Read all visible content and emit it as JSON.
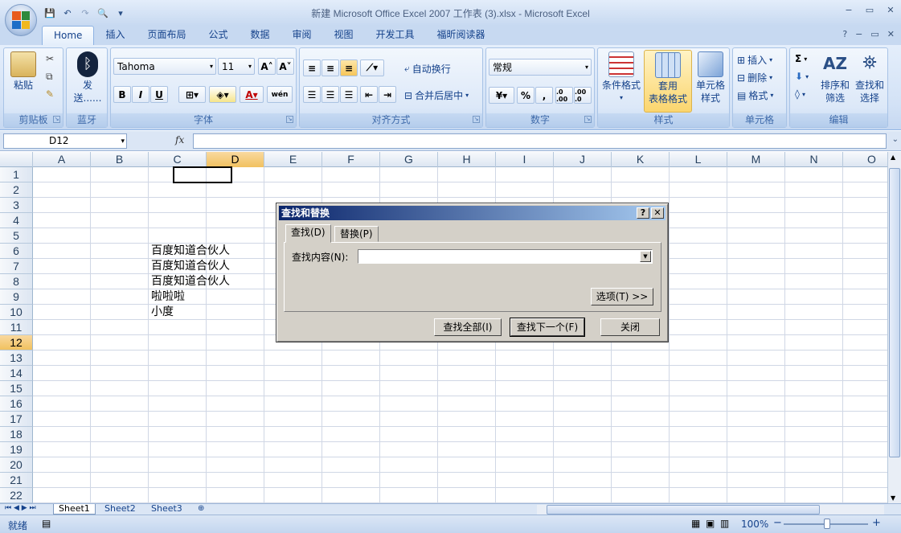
{
  "window": {
    "title": "新建 Microsoft Office Excel 2007 工作表 (3).xlsx - Microsoft Excel",
    "minimize": "−",
    "restore": "▭",
    "close": "✕"
  },
  "qat": {
    "save": "💾",
    "undo": "↶",
    "redo": "↷",
    "preview": "🔍",
    "more": "▾"
  },
  "tabs": [
    {
      "label": "Home",
      "active": true
    },
    {
      "label": "插入"
    },
    {
      "label": "页面布局"
    },
    {
      "label": "公式"
    },
    {
      "label": "数据"
    },
    {
      "label": "审阅"
    },
    {
      "label": "视图"
    },
    {
      "label": "开发工具"
    },
    {
      "label": "福昕阅读器"
    }
  ],
  "tab_controls": {
    "help": "?",
    "min": "−",
    "restore": "▭",
    "close": "✕"
  },
  "ribbon": {
    "clipboard": {
      "label": "剪贴板",
      "paste": "粘贴"
    },
    "bluetooth": {
      "label": "蓝牙",
      "send1": "发",
      "send2": "送......"
    },
    "font": {
      "label": "字体",
      "name": "Tahoma",
      "size": "11",
      "bold": "B",
      "italic": "I",
      "underline": "U",
      "grow": "A˄",
      "shrink": "A˅",
      "phonetic": "wén",
      "font_color": "A"
    },
    "align": {
      "label": "对齐方式",
      "wrap": "自动换行",
      "merge": "合并后居中"
    },
    "number": {
      "label": "数字",
      "format": "常规",
      "percent": "%",
      "comma": ",",
      "inc": ".0 .00",
      "dec": ".00 .0"
    },
    "styles": {
      "label": "样式",
      "cond1": "条件格式",
      "table1": "套用",
      "table2": "表格格式",
      "cell1": "单元格",
      "cell2": "样式"
    },
    "cells": {
      "label": "单元格",
      "insert": "插入",
      "delete": "删除",
      "format": "格式"
    },
    "edit": {
      "label": "编辑",
      "sort1": "排序和",
      "sort2": "筛选",
      "find1": "查找和",
      "find2": "选择",
      "sum": "Σ"
    }
  },
  "formula_bar": {
    "name_box": "D12",
    "fx": "fx",
    "value": ""
  },
  "columns": [
    "A",
    "B",
    "C",
    "D",
    "E",
    "F",
    "G",
    "H",
    "I",
    "J",
    "K",
    "L",
    "M",
    "N",
    "O"
  ],
  "selected_column": "D",
  "rows": [
    "1",
    "2",
    "3",
    "4",
    "5",
    "6",
    "7",
    "8",
    "9",
    "10",
    "11",
    "12",
    "13",
    "14",
    "15",
    "16",
    "17",
    "18",
    "19",
    "20",
    "21",
    "22"
  ],
  "selected_row": "12",
  "cells": [
    {
      "ref": "C6",
      "value": "百度知道合伙人"
    },
    {
      "ref": "C7",
      "value": "百度知道合伙人"
    },
    {
      "ref": "C8",
      "value": "百度知道合伙人"
    },
    {
      "ref": "C9",
      "value": "啦啦啦"
    },
    {
      "ref": "C10",
      "value": "小度"
    }
  ],
  "sheets": [
    {
      "label": "Sheet1",
      "active": true
    },
    {
      "label": "Sheet2"
    },
    {
      "label": "Sheet3"
    }
  ],
  "status": {
    "text": "就绪",
    "zoom": "100%",
    "zoom_minus": "−",
    "zoom_plus": "+"
  },
  "dialog": {
    "title": "查找和替换",
    "help": "?",
    "close": "✕",
    "tab_find": "查找(D)",
    "tab_replace": "替换(P)",
    "find_label": "查找内容(N):",
    "find_value": "",
    "options": "选项(T) >>",
    "find_all": "查找全部(I)",
    "find_next": "查找下一个(F)",
    "close_btn": "关闭"
  }
}
